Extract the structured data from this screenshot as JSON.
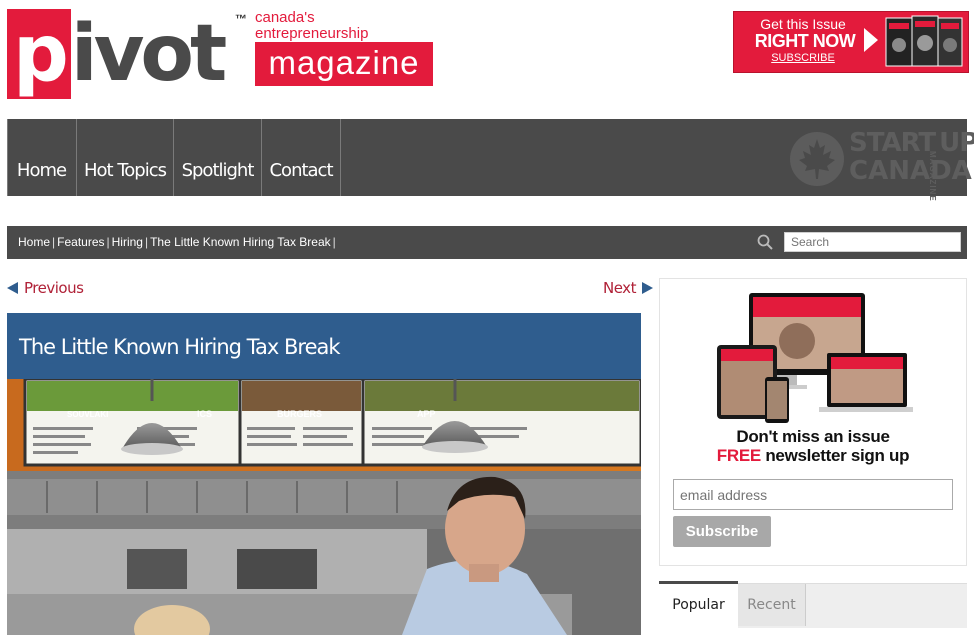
{
  "logo": {
    "wordmark": "pivot",
    "trademark": "™",
    "tagline_line1": "canada's",
    "tagline_line2": "entrepreneurship",
    "magazine": "magazine"
  },
  "promo": {
    "line1": "Get this Issue",
    "line2": "RIGHT NOW",
    "line3": "SUBSCRIBE"
  },
  "nav": {
    "items": [
      {
        "label": "Home"
      },
      {
        "label": "Hot Topics"
      },
      {
        "label": "Spotlight"
      },
      {
        "label": "Contact"
      }
    ],
    "brand_start": "START",
    "brand_up": "UP",
    "brand_canada": "CANADA",
    "brand_vertical": "MAGAZINE"
  },
  "breadcrumb": {
    "items": [
      "Home",
      "Features",
      "Hiring",
      "The Little Known Hiring Tax Break"
    ],
    "separator": "|"
  },
  "search": {
    "placeholder": "Search"
  },
  "pager": {
    "previous": "Previous",
    "next": "Next"
  },
  "article": {
    "title": "The Little Known Hiring Tax Break"
  },
  "menu_boards": [
    "SOUVLAKI",
    "ICS",
    "BURGERS",
    "APP"
  ],
  "newsletter": {
    "line1": "Don't miss an issue",
    "free": "FREE",
    "line2_rest": " newsletter sign up",
    "email_placeholder": "email address",
    "button": "Subscribe"
  },
  "tabs": [
    {
      "label": "Popular",
      "active": true
    },
    {
      "label": "Recent",
      "active": false
    }
  ],
  "colors": {
    "brand_red": "#e31b3c",
    "nav_gray": "#4a4a4a",
    "title_blue": "#2f5d8e",
    "link_red": "#b02137"
  }
}
